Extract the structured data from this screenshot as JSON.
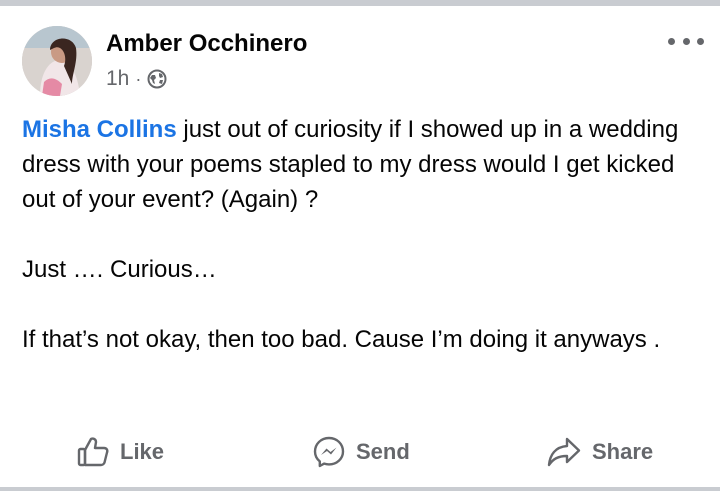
{
  "post": {
    "author": "Amber Occhinero",
    "time": "1h",
    "separator": "·",
    "privacy_icon": "globe-icon",
    "more_icon": "more-options-icon",
    "mention": "Misha Collins",
    "line1_rest": "just out of curiosity if I showed up in a wedding dress with your poems stapled  to my dress would I get kicked out of your event? (Again) ?",
    "paragraph2": "Just …. Curious…",
    "paragraph3": "If that’s not okay, then too bad. Cause I’m doing it anyways ."
  },
  "actions": {
    "like_label": "Like",
    "send_label": "Send",
    "share_label": "Share"
  },
  "colors": {
    "mention": "#1b74e4",
    "secondary_text": "#65676b",
    "divider": "#c9ccd1"
  }
}
